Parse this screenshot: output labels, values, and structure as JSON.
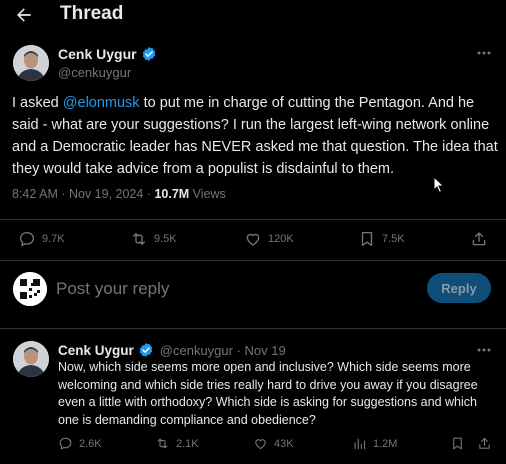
{
  "header": {
    "title": "Thread"
  },
  "main_post": {
    "author_name": "Cenk Uygur",
    "handle": "@cenkuygur",
    "text_before": "I asked ",
    "mention": "@elonmusk",
    "text_after": " to put me in charge of cutting the Pentagon. And he said - what are your suggestions? I run the largest left-wing network online and a Democratic leader has NEVER asked me that question. The idea that they would take advice from a populist is disdainful to them.",
    "timestamp": "8:42 AM · Nov 19, 2024 · ",
    "views_count": "10.7M",
    "views_label": " Views",
    "stats": {
      "replies": "9.7K",
      "reposts": "9.5K",
      "likes": "120K",
      "bookmarks": "7.5K"
    }
  },
  "composer": {
    "placeholder": "Post your reply",
    "button_label": "Reply"
  },
  "reply_post": {
    "author_name": "Cenk Uygur",
    "handle_date": "@cenkuygur · Nov 19",
    "text": "Now, which side seems more open and inclusive? Which side seems more welcoming and which side tries really hard to drive you away if you disagree even a little with orthodoxy? Which side is asking for suggestions and which one is demanding compliance and obedience?",
    "stats": {
      "replies": "2.6K",
      "reposts": "2.1K",
      "likes": "43K",
      "views": "1.2M"
    }
  },
  "colors": {
    "accent": "#1d9bf0",
    "muted": "#71767b",
    "divider": "#2f3336",
    "background": "#000000"
  }
}
